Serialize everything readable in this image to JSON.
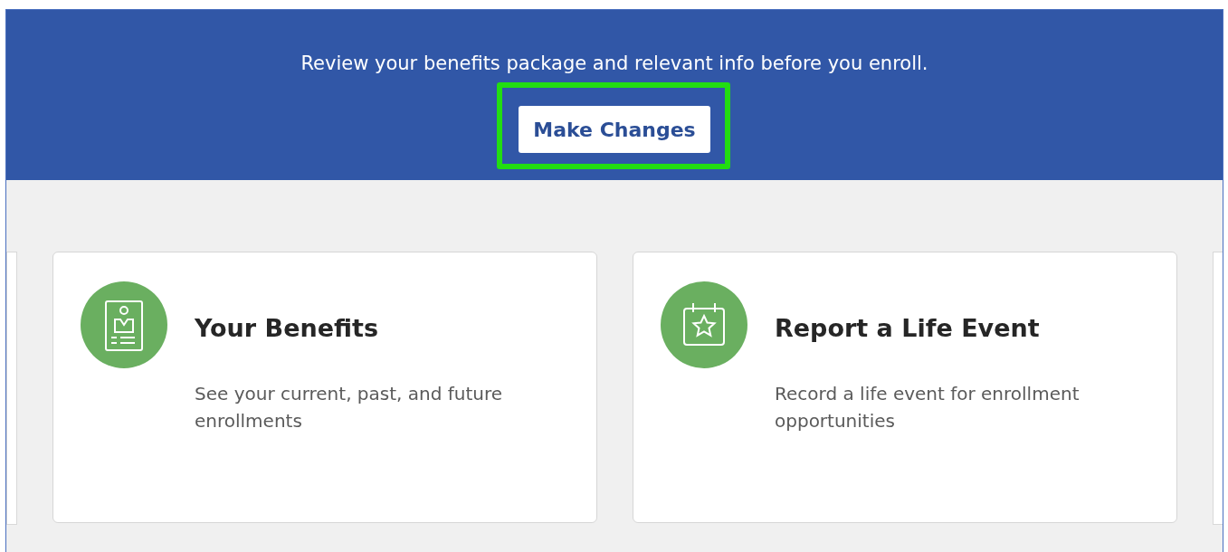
{
  "banner": {
    "message": "Review your benefits package and relevant info before you enroll.",
    "button": {
      "label": "Make Changes",
      "highlighted": true
    }
  },
  "cards": [
    {
      "kind": "id-badge",
      "title": "Your Benefits",
      "description": "See your current, past, and future enrollments"
    },
    {
      "kind": "calendar-star",
      "title": "Report a Life Event",
      "description": "Record a life event for enrollment opportunities"
    }
  ]
}
